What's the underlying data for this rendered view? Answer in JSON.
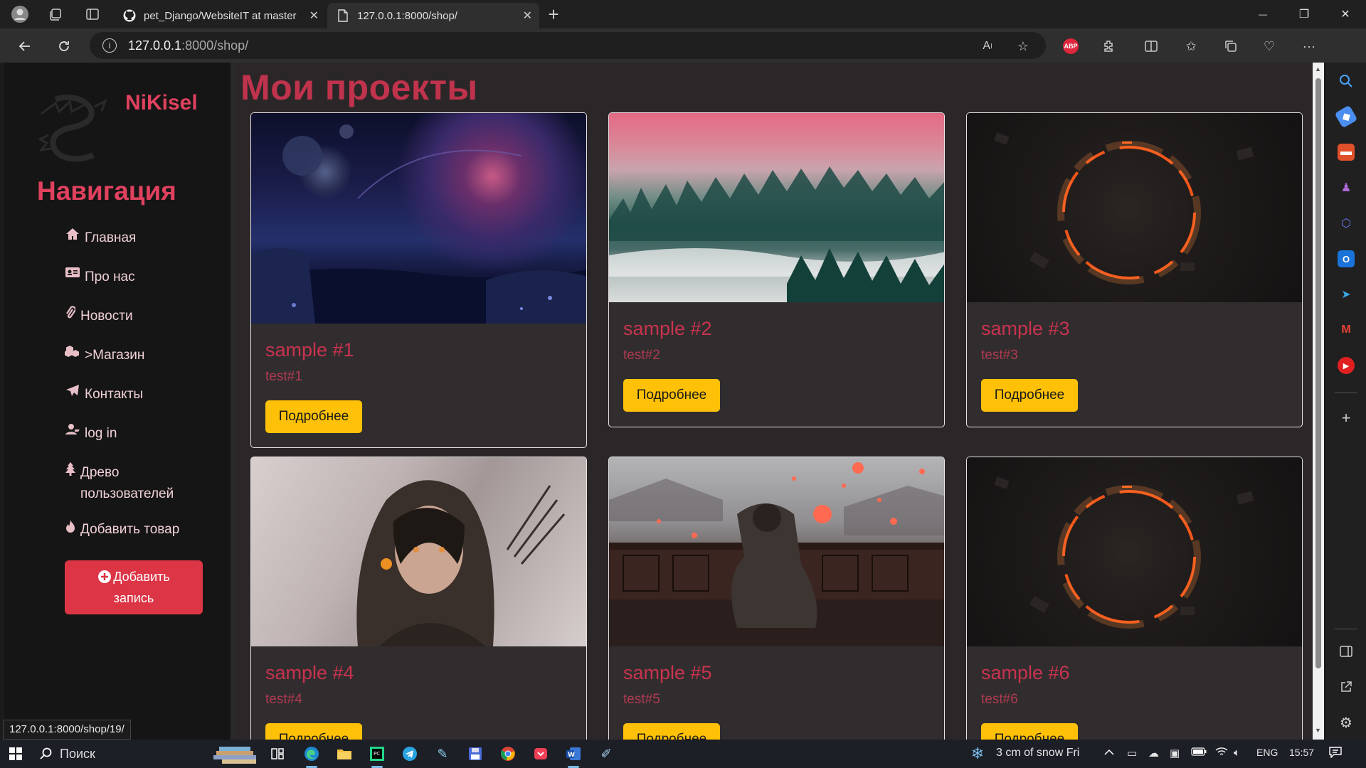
{
  "browser": {
    "tabs": [
      {
        "title": "pet_Django/WebsiteIT at master",
        "close": "✕"
      },
      {
        "title": "127.0.0.1:8000/shop/",
        "close": "✕"
      }
    ],
    "new_tab": "+",
    "window_controls": {
      "minimize": "—",
      "maximize": "❐",
      "close": "✕"
    },
    "url_host": "127.0.0.1",
    "url_path": ":8000/shop/",
    "info_icon": "i",
    "extension_abp": "ABP"
  },
  "site": {
    "brand": "NiKisel",
    "nav_title": "Навигация",
    "nav": [
      {
        "icon": "home-icon",
        "label": "Главная"
      },
      {
        "icon": "id-card-icon",
        "label": "Про нас"
      },
      {
        "icon": "paperclip-icon",
        "label": "Новости"
      },
      {
        "icon": "cubes-icon",
        "label": ">Магазин"
      },
      {
        "icon": "paper-plane-icon",
        "label": "Контакты"
      },
      {
        "icon": "user-icon",
        "label": "log in"
      },
      {
        "icon": "tree-icon",
        "label": "Древо пользователей"
      },
      {
        "icon": "fire-icon",
        "label": "Добавить товар"
      }
    ],
    "add_post_button": {
      "line1": "Добавить",
      "line2": "запись",
      "icon": "plus-circle-icon"
    },
    "page_title": "Мои проекты",
    "cards": [
      {
        "title": "sample #1",
        "text": "test#1",
        "button": "Подробнее",
        "image": "space-planet-image"
      },
      {
        "title": "sample #2",
        "text": "test#2",
        "button": "Подробнее",
        "image": "misty-forest-image"
      },
      {
        "title": "sample #3",
        "text": "test#3",
        "button": "Подробнее",
        "image": "fire-ring-image"
      },
      {
        "title": "sample #4",
        "text": "test#4",
        "button": "Подробнее",
        "image": "hooded-archer-image"
      },
      {
        "title": "sample #5",
        "text": "test#5",
        "button": "Подробнее",
        "image": "lanterns-balcony-image"
      },
      {
        "title": "sample #6",
        "text": "test#6",
        "button": "Подробнее",
        "image": "fire-ring-image"
      }
    ],
    "status_url": "127.0.0.1:8000/shop/19/"
  },
  "taskbar": {
    "search_placeholder": "Поиск",
    "weather": "3 cm of snow Fri",
    "language": "ENG",
    "time": "15:57"
  },
  "colors": {
    "accent": "#c8334f",
    "button_warning": "#ffc107",
    "button_danger": "#dc3545",
    "card_bg": "#312d2e",
    "main_bg": "#2b2728"
  }
}
